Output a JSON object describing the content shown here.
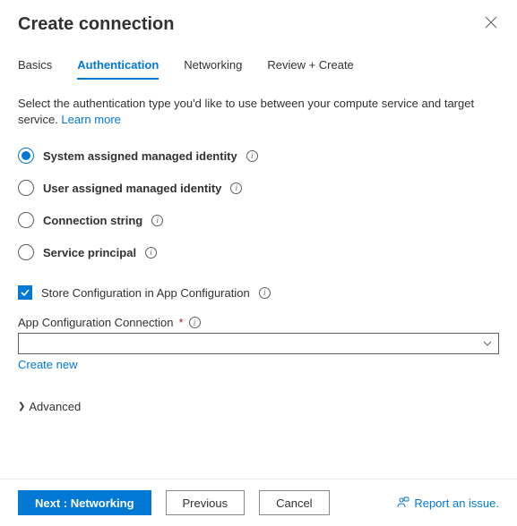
{
  "header": {
    "title": "Create connection"
  },
  "tabs": {
    "items": [
      {
        "label": "Basics"
      },
      {
        "label": "Authentication"
      },
      {
        "label": "Networking"
      },
      {
        "label": "Review + Create"
      }
    ],
    "activeIndex": 1
  },
  "description": {
    "text": "Select the authentication type you'd like to use between your compute service and target service. ",
    "learnMore": "Learn more"
  },
  "authOptions": [
    {
      "label": "System assigned managed identity",
      "selected": true
    },
    {
      "label": "User assigned managed identity",
      "selected": false
    },
    {
      "label": "Connection string",
      "selected": false
    },
    {
      "label": "Service principal",
      "selected": false
    }
  ],
  "storeConfig": {
    "label": "Store Configuration in App Configuration",
    "checked": true
  },
  "appConfigField": {
    "label": "App Configuration Connection",
    "required": "*",
    "createNew": "Create new"
  },
  "advanced": {
    "label": "Advanced"
  },
  "footer": {
    "next": "Next : Networking",
    "previous": "Previous",
    "cancel": "Cancel",
    "report": "Report an issue."
  }
}
